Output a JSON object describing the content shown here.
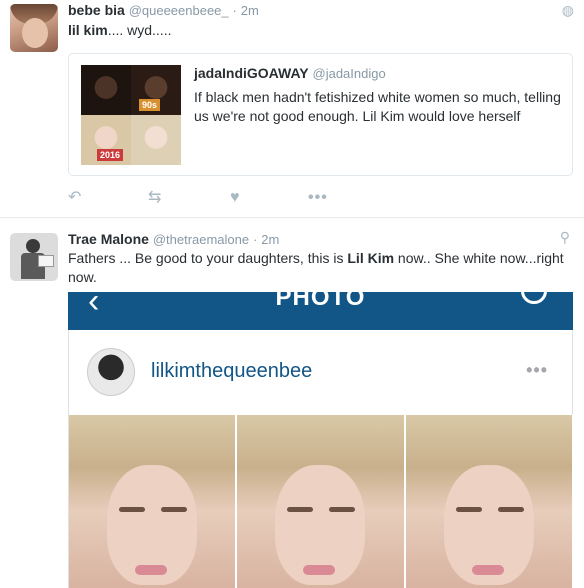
{
  "tweets": [
    {
      "author_name": "bebe bia",
      "author_handle": "@queeeenbeee_",
      "time": "2m",
      "text_bold": "lil kim",
      "text_rest": ".... wyd.....",
      "quote": {
        "author_name": "jadaIndiGOAWAY",
        "author_handle": "@jadaIndigo",
        "text": "If black men hadn't fetishized white women so much, telling us we're not good enough. Lil Kim would love herself",
        "thumb_labels": [
          "90s",
          "2016"
        ]
      },
      "actions": {
        "reply_icon": "reply-icon",
        "retweet_icon": "retweet-icon",
        "like_icon": "heart-icon",
        "more_icon": "more-icon"
      }
    },
    {
      "author_name": "Trae Malone",
      "author_handle": "@thetraemalone",
      "time": "2m",
      "text_pre": "Fathers ... Be good to your daughters, this is ",
      "text_bold": "Lil Kim",
      "text_post": " now.. She white now...right now.",
      "media": {
        "app_title": "PHOTO",
        "username": "lilkimthequeenbee",
        "brand_color": "#125688"
      }
    }
  ],
  "glyphs": {
    "dot": "·",
    "reply": "↶",
    "retweet": "⇆",
    "heart": "♥",
    "more": "•••",
    "globe": "◍",
    "pin": "⚲",
    "back": "‹"
  }
}
